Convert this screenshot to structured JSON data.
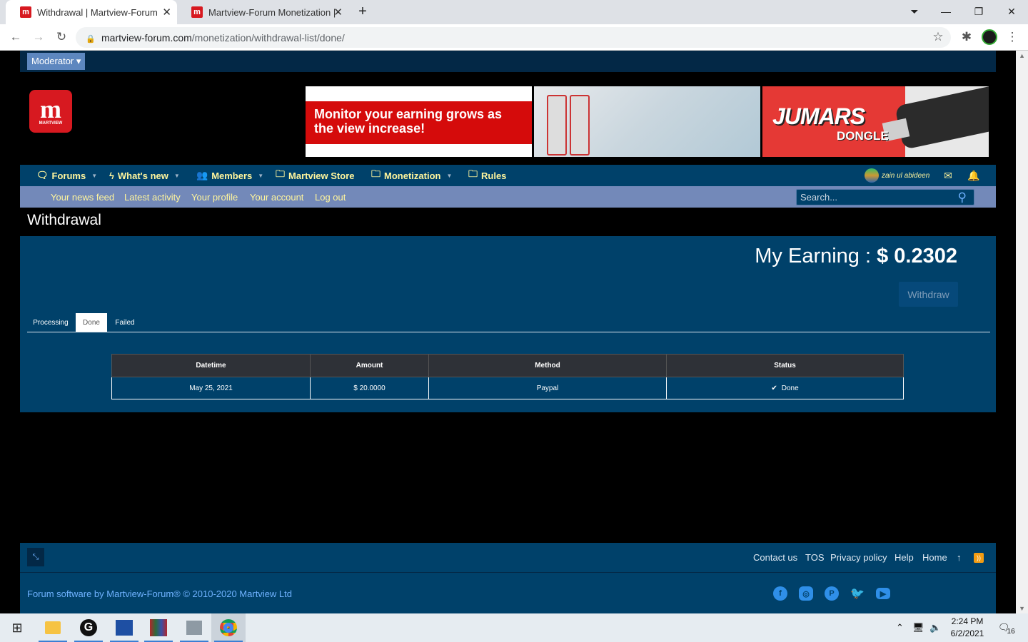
{
  "browser": {
    "tabs": [
      {
        "title": "Withdrawal | Martview-Forum",
        "active": true
      },
      {
        "title": "Martview-Forum Monetization | M",
        "active": false
      }
    ],
    "new_tab": "+",
    "url_host": "martview-forum.com",
    "url_path": "/monetization/withdrawal-list/done/"
  },
  "staff_bar": {
    "moderator_label": "Moderator ▾"
  },
  "logo": {
    "text": "MARTVIEW"
  },
  "banners": {
    "banner1_text": "Monitor your earning grows as the view increase!",
    "banner3_brand": "JUMARS",
    "banner3_sub": "DONGLE"
  },
  "nav": {
    "items": [
      {
        "label": "Forums",
        "icon": "comments-icon"
      },
      {
        "label": "What's new",
        "icon": "bolt-icon"
      },
      {
        "label": "Members",
        "icon": "users-icon"
      },
      {
        "label": "Martview Store",
        "icon": "folder-icon"
      },
      {
        "label": "Monetization",
        "icon": "folder-icon"
      },
      {
        "label": "Rules",
        "icon": "folder-icon"
      }
    ],
    "username": "zain ul abideen"
  },
  "subnav": {
    "items": [
      "Your news feed",
      "Latest activity",
      "Your profile",
      "Your account",
      "Log out"
    ],
    "search_placeholder": "Search..."
  },
  "page": {
    "title": "Withdrawal",
    "earning_label": "My Earning : ",
    "earning_value": "$ 0.2302",
    "withdraw_button": "Withdraw",
    "tabs": [
      {
        "label": "Processing",
        "active": false
      },
      {
        "label": "Done",
        "active": true
      },
      {
        "label": "Failed",
        "active": false
      }
    ]
  },
  "table": {
    "headers": [
      "Datetime",
      "Amount",
      "Method",
      "Status"
    ],
    "rows": [
      {
        "datetime": "May 25, 2021",
        "amount": "$ 20.0000",
        "method": "Paypal",
        "status": "Done"
      }
    ]
  },
  "footer": {
    "links": [
      "Contact us",
      "TOS",
      "Privacy policy",
      "Help",
      "Home"
    ],
    "copyright": "Forum software by Martview-Forum® © 2010-2020 Martview Ltd",
    "social": [
      "facebook-icon",
      "instagram-icon",
      "pinterest-icon",
      "twitter-icon",
      "youtube-icon"
    ]
  },
  "taskbar": {
    "time": "2:24 PM",
    "date": "6/2/2021",
    "notifications": "16"
  },
  "colors": {
    "site_bg": "#000000",
    "panel": "#00416a",
    "nav_text": "#fff59d",
    "subnav": "#7389b9"
  }
}
